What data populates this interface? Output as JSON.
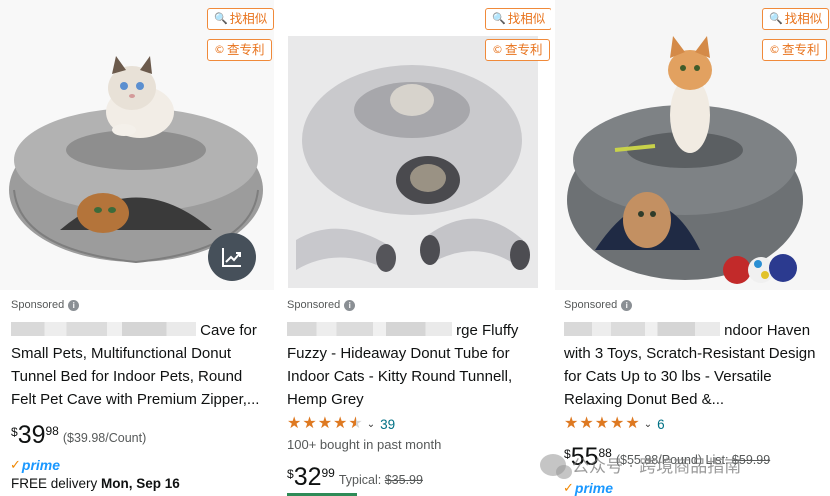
{
  "extension": {
    "find_similar_label": "找相似",
    "check_patent_label": "查专利"
  },
  "products": [
    {
      "sponsored_label": "Sponsored",
      "title_visible": "Cave for",
      "title_rest": "Small Pets, Multifunctional Donut Tunnel Bed for Indoor Pets, Round Felt Pet Cave with Premium Zipper,...",
      "price_symbol": "$",
      "price_whole": "39",
      "price_fraction": "98",
      "unit_price": "($39.98/Count)",
      "prime_label": "prime",
      "delivery_prefix": "FREE delivery ",
      "delivery_date": "Mon, Sep 16"
    },
    {
      "sponsored_label": "Sponsored",
      "title_visible": "rge Fluffy",
      "title_rest": "Fuzzy - Hideaway Donut Tube for Indoor Cats - Kitty Round Tunnell, Hemp Grey",
      "rating_stars": 4.5,
      "review_count": "39",
      "bought_text": "100+ bought in past month",
      "price_symbol": "$",
      "price_whole": "32",
      "price_fraction": "99",
      "typical_label": "Typical: ",
      "typical_price": "$35.99"
    },
    {
      "sponsored_label": "Sponsored",
      "title_visible": "ndoor Haven",
      "title_rest": "with 3 Toys, Scratch-Resistant Design for Cats Up to 30 lbs - Versatile Relaxing Donut Bed &...",
      "rating_stars": 5,
      "review_count": "6",
      "price_symbol": "$",
      "price_whole": "55",
      "price_fraction": "88",
      "unit_price": "($55.88/Pound)",
      "list_label": "List: ",
      "list_price": "$59.99",
      "prime_label": "prime"
    }
  ],
  "watermark": {
    "text": "公众号 · 跨境商品指南"
  },
  "colors": {
    "accent_orange": "#e8741e",
    "prime_blue": "#1a98ff",
    "star": "#de7921",
    "link": "#007185"
  }
}
